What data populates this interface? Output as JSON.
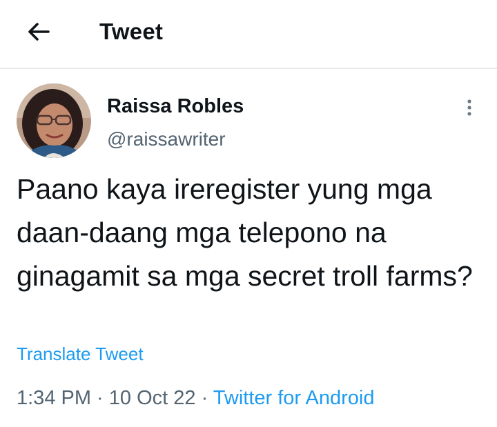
{
  "header": {
    "title": "Tweet",
    "back_icon": "arrow-left-icon"
  },
  "tweet": {
    "author_name": "Raissa Robles",
    "author_handle": "@raissawriter",
    "more_icon": "more-vertical-icon",
    "text": "Paano kaya ireregister yung mga daan-daang mga telepono na ginagamit sa mga secret troll farms?",
    "translate_label": "Translate Tweet",
    "time": "1:34 PM",
    "separator": " · ",
    "date": "10 Oct 22",
    "source": "Twitter for Android"
  },
  "colors": {
    "accent": "#1d9bf0",
    "secondary_text": "#536471",
    "divider": "#e8ebed"
  }
}
